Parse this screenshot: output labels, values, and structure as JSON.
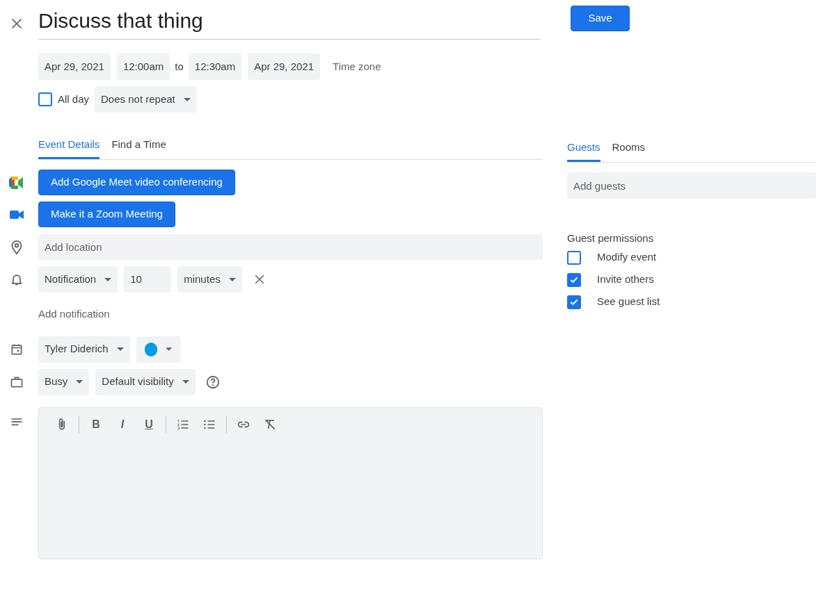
{
  "title": "Discuss that thing",
  "save_button": "Save",
  "datetime": {
    "start_date": "Apr 29, 2021",
    "start_time": "12:00am",
    "separator": "to",
    "end_time": "12:30am",
    "end_date": "Apr 29, 2021",
    "time_zone": "Time zone"
  },
  "all_day": {
    "label": "All day",
    "checked": false
  },
  "repeat": "Does not repeat",
  "tabs": [
    {
      "label": "Event Details",
      "selected": true
    },
    {
      "label": "Find a Time",
      "selected": false
    }
  ],
  "conferencing": [
    {
      "kind": "meet",
      "label": "Add Google Meet video conferencing"
    },
    {
      "kind": "zoom",
      "label": "Make it a Zoom Meeting"
    }
  ],
  "location": {
    "placeholder": "Add location"
  },
  "notification": {
    "type": "Notification",
    "amount": "10",
    "unit": "minutes"
  },
  "add_notification": "Add notification",
  "calendar": {
    "owner": "Tyler Diderich",
    "color": "#039be5"
  },
  "availability": "Busy",
  "visibility": "Default visibility",
  "description_toolbar": [
    [
      {
        "kind": "attach"
      }
    ],
    [
      {
        "kind": "bold",
        "glyph": "B"
      },
      {
        "kind": "italic",
        "glyph": "I"
      },
      {
        "kind": "underline",
        "glyph": "U"
      }
    ],
    [
      {
        "kind": "numbered"
      },
      {
        "kind": "bulleted"
      }
    ],
    [
      {
        "kind": "link"
      },
      {
        "kind": "clear"
      }
    ]
  ],
  "guest_tabs": [
    {
      "label": "Guests",
      "selected": true
    },
    {
      "label": "Rooms",
      "selected": false
    }
  ],
  "guests": {
    "placeholder": "Add guests"
  },
  "permissions": {
    "title": "Guest permissions",
    "items": [
      {
        "label": "Modify event",
        "checked": false
      },
      {
        "label": "Invite others",
        "checked": true
      },
      {
        "label": "See guest list",
        "checked": true
      }
    ]
  }
}
